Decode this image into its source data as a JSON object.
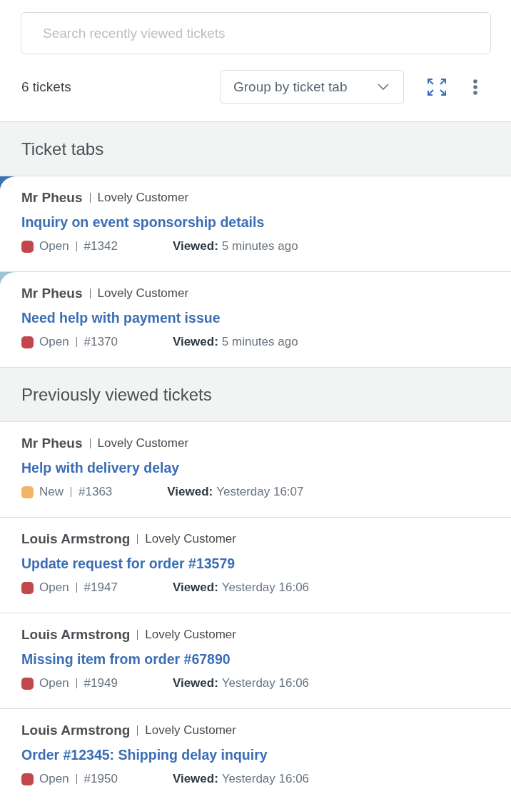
{
  "search": {
    "placeholder": "Search recently viewed tickets"
  },
  "toolbar": {
    "count": "6 tickets",
    "group_by": "Group by ticket tab"
  },
  "sections": [
    {
      "title": "Ticket tabs",
      "tickets": [
        {
          "requester": "Mr Pheus",
          "organization": "Lovely Customer",
          "subject": "Inquiry on event sponsorship details",
          "status": {
            "label": "Open",
            "color": "#c2464b"
          },
          "number": "#1342",
          "viewed_label": "Viewed:",
          "viewed": "5 minutes ago",
          "color": "#3d72b8"
        },
        {
          "requester": "Mr Pheus",
          "organization": "Lovely Customer",
          "subject": "Need help with payment issue",
          "status": {
            "label": "Open",
            "color": "#c2464b"
          },
          "number": "#1370",
          "viewed_label": "Viewed:",
          "viewed": "5 minutes ago",
          "color": "#9fc4d2"
        }
      ]
    },
    {
      "title": "Previously viewed tickets",
      "tickets": [
        {
          "requester": "Mr Pheus",
          "organization": "Lovely Customer",
          "subject": "Help with delivery delay",
          "status": {
            "label": "New",
            "color": "#f2b466"
          },
          "number": "#1363",
          "viewed_label": "Viewed:",
          "viewed": "Yesterday 16:07"
        },
        {
          "requester": "Louis Armstrong",
          "organization": "Lovely Customer",
          "subject": "Update request for order #13579",
          "status": {
            "label": "Open",
            "color": "#c2464b"
          },
          "number": "#1947",
          "viewed_label": "Viewed:",
          "viewed": "Yesterday 16:06"
        },
        {
          "requester": "Louis Armstrong",
          "organization": "Lovely Customer",
          "subject": "Missing item from order #67890",
          "status": {
            "label": "Open",
            "color": "#c2464b"
          },
          "number": "#1949",
          "viewed_label": "Viewed:",
          "viewed": "Yesterday 16:06"
        },
        {
          "requester": "Louis Armstrong",
          "organization": "Lovely Customer",
          "subject": "Order #12345: Shipping delay inquiry",
          "status": {
            "label": "Open",
            "color": "#c2464b"
          },
          "number": "#1950",
          "viewed_label": "Viewed:",
          "viewed": "Yesterday 16:06"
        }
      ]
    }
  ]
}
